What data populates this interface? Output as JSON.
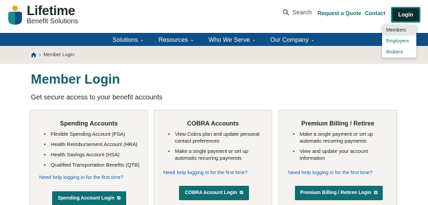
{
  "header": {
    "logo_name": "Lifetime",
    "logo_sub": "Benefit Solutions",
    "search_label": "Search",
    "request_quote": "Request a Quote",
    "contact": "Contact",
    "login": "Login"
  },
  "login_menu": {
    "items": [
      "Members",
      "Employers",
      "Brokers"
    ]
  },
  "nav": {
    "items": [
      "Solutions",
      "Resources",
      "Who We Serve",
      "Our Company"
    ]
  },
  "breadcrumb": {
    "current": "Member Login"
  },
  "main": {
    "title": "Member Login",
    "subtitle": "Get secure access to your benefit accounts"
  },
  "cards": [
    {
      "title": "Spending Accounts",
      "bullets": [
        "Flexible Spending Account (FSA)",
        "Health Reimbursement Account (HRA)",
        "Health Savings Account (HSA)",
        "Qualified Transportation Benefits (QTB)"
      ],
      "help": "Need help logging in for the first time?",
      "button": "Spending Account Login"
    },
    {
      "title": "COBRA Accounts",
      "bullets": [
        "View Cobra plan and update personal contact preferences",
        "Make a single payment or set up automatic recurring payments"
      ],
      "help": "Need help logging in for the first time?",
      "button": "COBRA Account Login"
    },
    {
      "title": "Premium Billing / Retiree",
      "bullets": [
        "Make a single payment or set up automatic recurring payments",
        "View and update your account information"
      ],
      "help": "Need help logging in for the first time?",
      "button": "Premium Billing / Retiree Login"
    }
  ],
  "colors": {
    "nav_bg": "#0e4f86",
    "accent_teal": "#0f6f73",
    "title_teal": "#0f5f63",
    "link_blue": "#1a5fb0",
    "login_bg": "#0d2f2f"
  }
}
